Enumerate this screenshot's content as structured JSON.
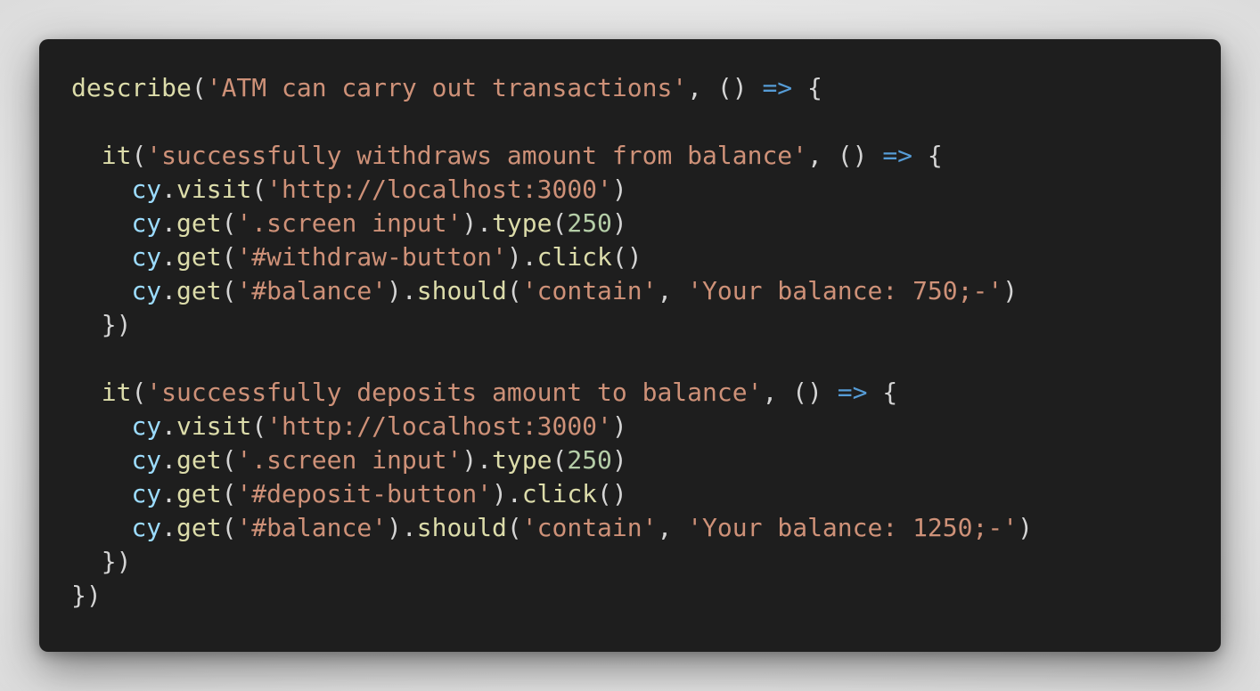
{
  "colors": {
    "background": "#1e1e1e",
    "page": "#e8e8e8",
    "function": "#dcdcaa",
    "string": "#ce9178",
    "number": "#b5cea8",
    "variable": "#9cdcfe",
    "keyword": "#569cd6",
    "punctuation": "#d4d4d4"
  },
  "code": {
    "language": "javascript",
    "lines": [
      [
        {
          "t": "func",
          "v": "describe"
        },
        {
          "t": "punc",
          "v": "("
        },
        {
          "t": "str",
          "v": "'ATM can carry out transactions'"
        },
        {
          "t": "punc",
          "v": ", () "
        },
        {
          "t": "kw",
          "v": "=>"
        },
        {
          "t": "punc",
          "v": " {"
        }
      ],
      [],
      [
        {
          "t": "punc",
          "v": "  "
        },
        {
          "t": "func",
          "v": "it"
        },
        {
          "t": "punc",
          "v": "("
        },
        {
          "t": "str",
          "v": "'successfully withdraws amount from balance'"
        },
        {
          "t": "punc",
          "v": ", () "
        },
        {
          "t": "kw",
          "v": "=>"
        },
        {
          "t": "punc",
          "v": " {"
        }
      ],
      [
        {
          "t": "punc",
          "v": "    "
        },
        {
          "t": "var",
          "v": "cy"
        },
        {
          "t": "punc",
          "v": "."
        },
        {
          "t": "func",
          "v": "visit"
        },
        {
          "t": "punc",
          "v": "("
        },
        {
          "t": "str",
          "v": "'http://localhost:3000'"
        },
        {
          "t": "punc",
          "v": ")"
        }
      ],
      [
        {
          "t": "punc",
          "v": "    "
        },
        {
          "t": "var",
          "v": "cy"
        },
        {
          "t": "punc",
          "v": "."
        },
        {
          "t": "func",
          "v": "get"
        },
        {
          "t": "punc",
          "v": "("
        },
        {
          "t": "str",
          "v": "'.screen input'"
        },
        {
          "t": "punc",
          "v": ")."
        },
        {
          "t": "func",
          "v": "type"
        },
        {
          "t": "punc",
          "v": "("
        },
        {
          "t": "num",
          "v": "250"
        },
        {
          "t": "punc",
          "v": ")"
        }
      ],
      [
        {
          "t": "punc",
          "v": "    "
        },
        {
          "t": "var",
          "v": "cy"
        },
        {
          "t": "punc",
          "v": "."
        },
        {
          "t": "func",
          "v": "get"
        },
        {
          "t": "punc",
          "v": "("
        },
        {
          "t": "str",
          "v": "'#withdraw-button'"
        },
        {
          "t": "punc",
          "v": ")."
        },
        {
          "t": "func",
          "v": "click"
        },
        {
          "t": "punc",
          "v": "()"
        }
      ],
      [
        {
          "t": "punc",
          "v": "    "
        },
        {
          "t": "var",
          "v": "cy"
        },
        {
          "t": "punc",
          "v": "."
        },
        {
          "t": "func",
          "v": "get"
        },
        {
          "t": "punc",
          "v": "("
        },
        {
          "t": "str",
          "v": "'#balance'"
        },
        {
          "t": "punc",
          "v": ")."
        },
        {
          "t": "func",
          "v": "should"
        },
        {
          "t": "punc",
          "v": "("
        },
        {
          "t": "str",
          "v": "'contain'"
        },
        {
          "t": "punc",
          "v": ", "
        },
        {
          "t": "str",
          "v": "'Your balance: 750;-'"
        },
        {
          "t": "punc",
          "v": ")"
        }
      ],
      [
        {
          "t": "punc",
          "v": "  })"
        }
      ],
      [],
      [
        {
          "t": "punc",
          "v": "  "
        },
        {
          "t": "func",
          "v": "it"
        },
        {
          "t": "punc",
          "v": "("
        },
        {
          "t": "str",
          "v": "'successfully deposits amount to balance'"
        },
        {
          "t": "punc",
          "v": ", () "
        },
        {
          "t": "kw",
          "v": "=>"
        },
        {
          "t": "punc",
          "v": " {"
        }
      ],
      [
        {
          "t": "punc",
          "v": "    "
        },
        {
          "t": "var",
          "v": "cy"
        },
        {
          "t": "punc",
          "v": "."
        },
        {
          "t": "func",
          "v": "visit"
        },
        {
          "t": "punc",
          "v": "("
        },
        {
          "t": "str",
          "v": "'http://localhost:3000'"
        },
        {
          "t": "punc",
          "v": ")"
        }
      ],
      [
        {
          "t": "punc",
          "v": "    "
        },
        {
          "t": "var",
          "v": "cy"
        },
        {
          "t": "punc",
          "v": "."
        },
        {
          "t": "func",
          "v": "get"
        },
        {
          "t": "punc",
          "v": "("
        },
        {
          "t": "str",
          "v": "'.screen input'"
        },
        {
          "t": "punc",
          "v": ")."
        },
        {
          "t": "func",
          "v": "type"
        },
        {
          "t": "punc",
          "v": "("
        },
        {
          "t": "num",
          "v": "250"
        },
        {
          "t": "punc",
          "v": ")"
        }
      ],
      [
        {
          "t": "punc",
          "v": "    "
        },
        {
          "t": "var",
          "v": "cy"
        },
        {
          "t": "punc",
          "v": "."
        },
        {
          "t": "func",
          "v": "get"
        },
        {
          "t": "punc",
          "v": "("
        },
        {
          "t": "str",
          "v": "'#deposit-button'"
        },
        {
          "t": "punc",
          "v": ")."
        },
        {
          "t": "func",
          "v": "click"
        },
        {
          "t": "punc",
          "v": "()"
        }
      ],
      [
        {
          "t": "punc",
          "v": "    "
        },
        {
          "t": "var",
          "v": "cy"
        },
        {
          "t": "punc",
          "v": "."
        },
        {
          "t": "func",
          "v": "get"
        },
        {
          "t": "punc",
          "v": "("
        },
        {
          "t": "str",
          "v": "'#balance'"
        },
        {
          "t": "punc",
          "v": ")."
        },
        {
          "t": "func",
          "v": "should"
        },
        {
          "t": "punc",
          "v": "("
        },
        {
          "t": "str",
          "v": "'contain'"
        },
        {
          "t": "punc",
          "v": ", "
        },
        {
          "t": "str",
          "v": "'Your balance: 1250;-'"
        },
        {
          "t": "punc",
          "v": ")"
        }
      ],
      [
        {
          "t": "punc",
          "v": "  })"
        }
      ],
      [
        {
          "t": "punc",
          "v": "})"
        }
      ]
    ]
  }
}
